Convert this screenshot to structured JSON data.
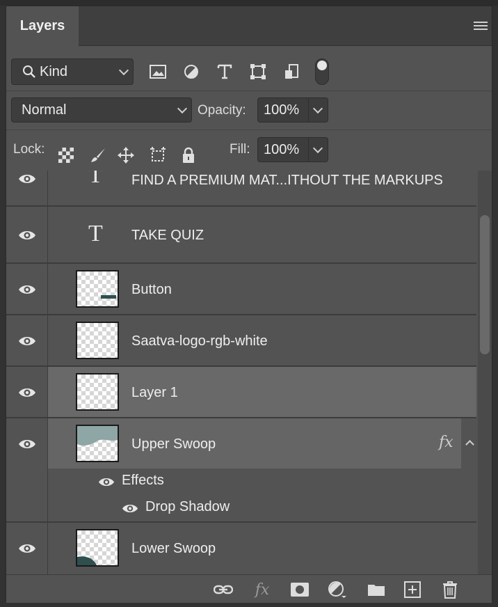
{
  "panel": {
    "tab_label": "Layers"
  },
  "filter": {
    "kind_label": "Kind"
  },
  "blend": {
    "mode": "Normal",
    "opacity_label": "Opacity:",
    "opacity_value": "100%"
  },
  "lock": {
    "label": "Lock:",
    "fill_label": "Fill:",
    "fill_value": "100%"
  },
  "layers": [
    {
      "name": "FIND A PREMIUM MAT...ITHOUT THE MARKUPS",
      "type": "text"
    },
    {
      "name": "TAKE QUIZ",
      "type": "text"
    },
    {
      "name": "Button",
      "type": "image"
    },
    {
      "name": "Saatva-logo-rgb-white",
      "type": "image"
    },
    {
      "name": "Layer 1",
      "type": "image",
      "selected": true
    },
    {
      "name": "Upper Swoop",
      "type": "image",
      "has_effects": true,
      "fx_label": "fx"
    },
    {
      "name": "Lower Swoop",
      "type": "image"
    }
  ],
  "effects": {
    "label": "Effects",
    "items": [
      "Drop Shadow"
    ]
  },
  "bottom_toolbar": {
    "fx_label": "fx"
  },
  "colors": {
    "panel_bg": "#535353",
    "selected_row": "#696969",
    "teal": "#2f4f4f"
  }
}
